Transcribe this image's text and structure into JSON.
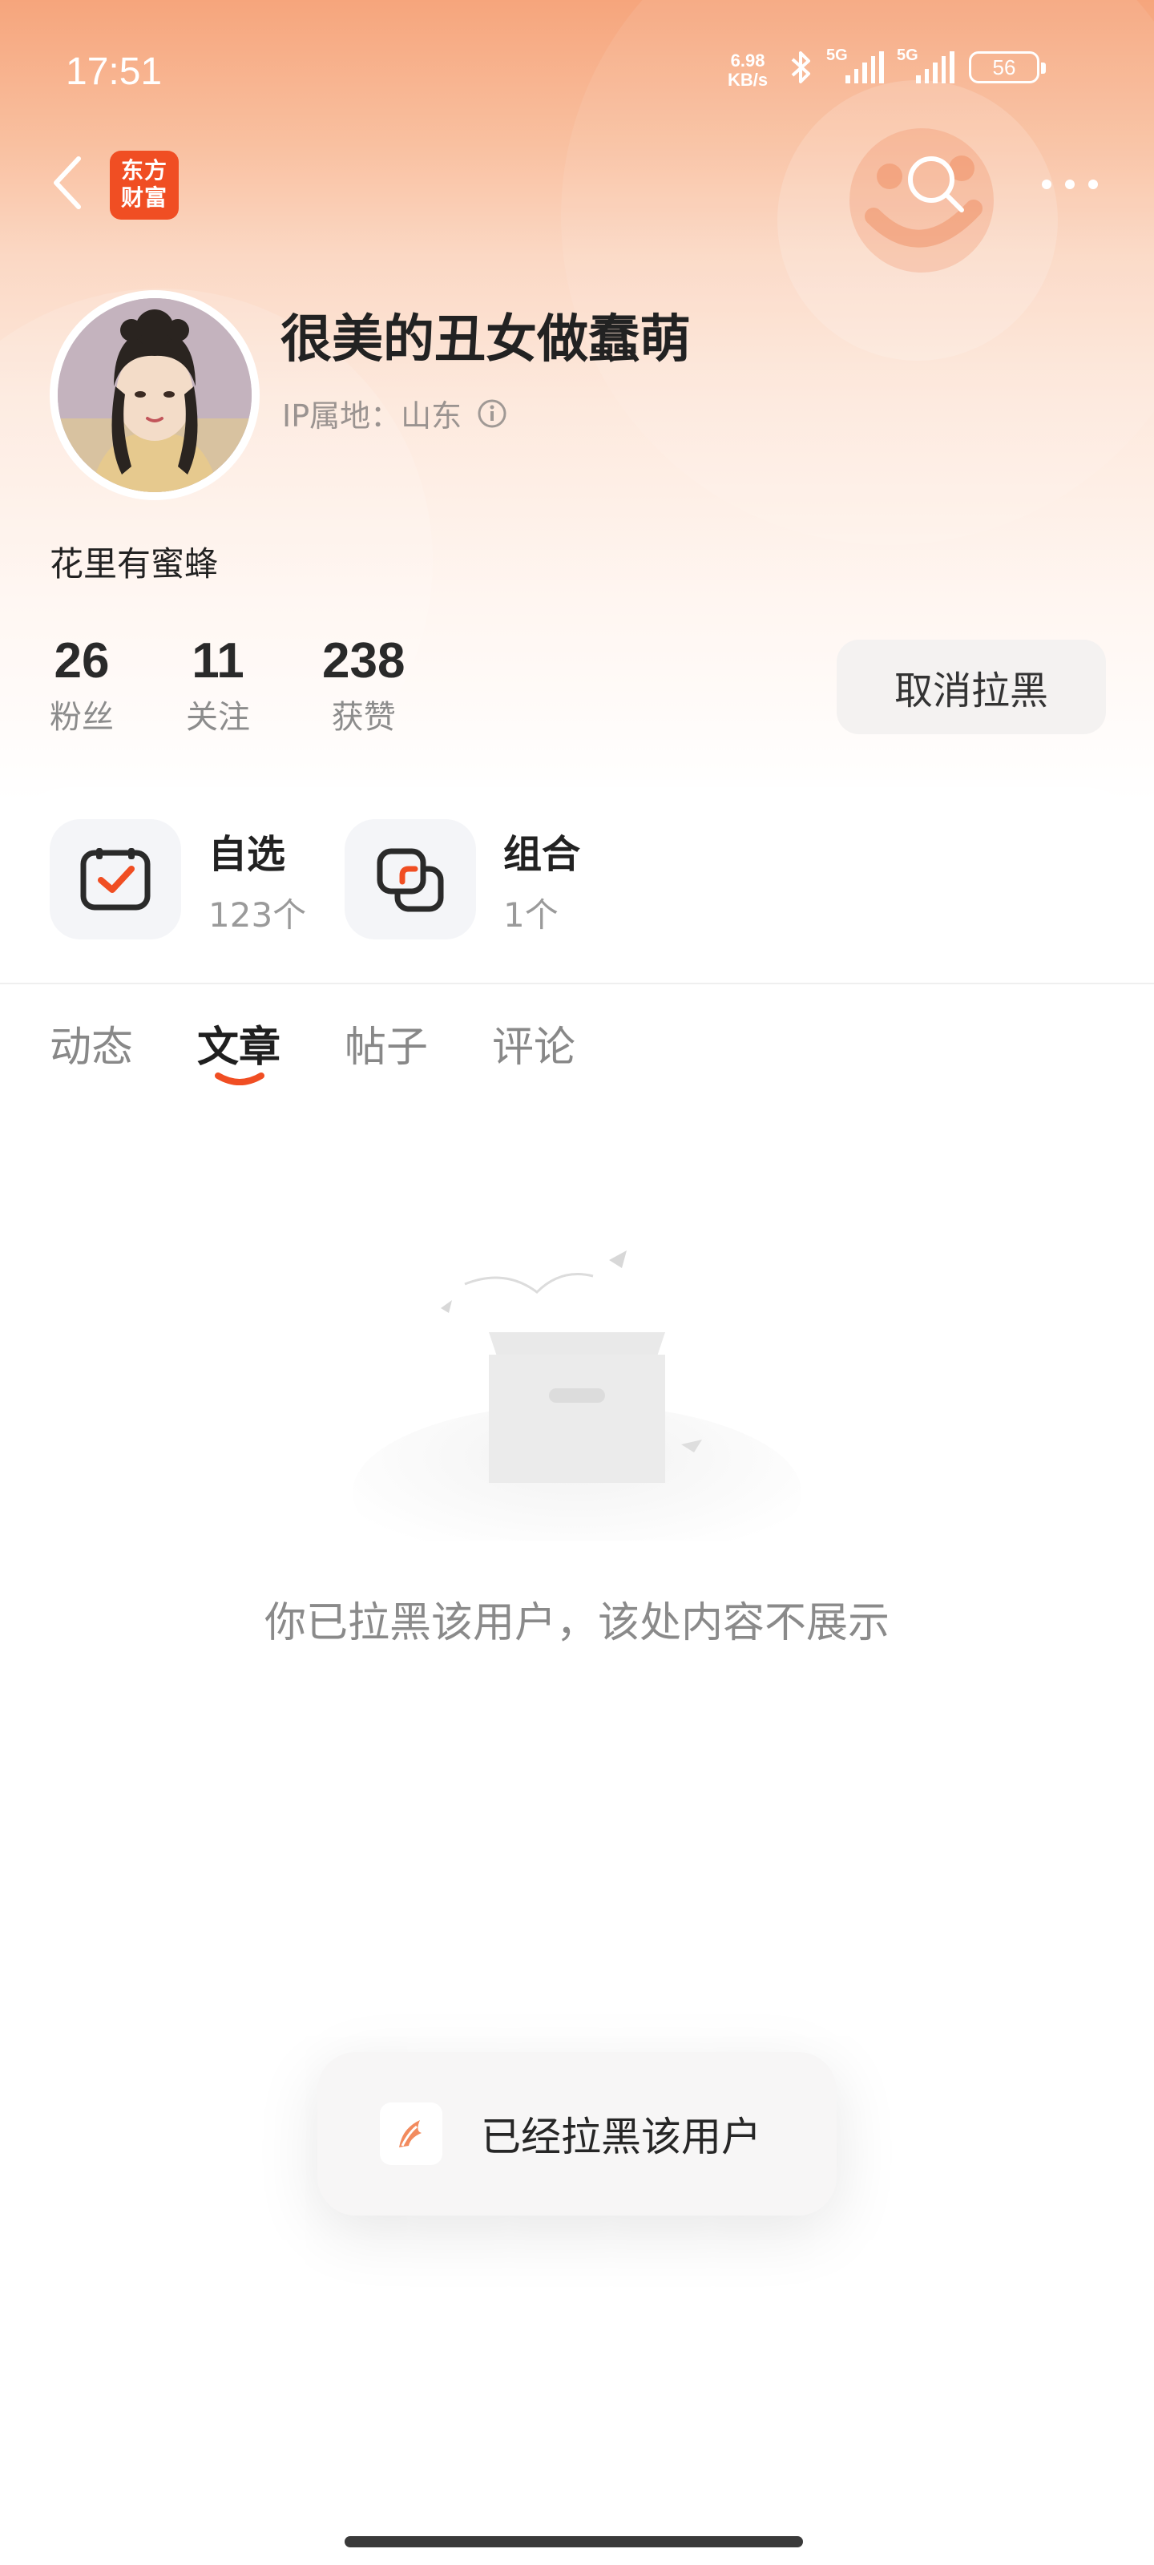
{
  "status_bar": {
    "time": "17:51",
    "net_speed_value": "6.98",
    "net_speed_unit": "KB/s",
    "signal1_label": "5G",
    "signal2_label": "5G",
    "battery": "56"
  },
  "nav": {
    "app_logo_line1": "东方",
    "app_logo_line2": "财富",
    "back_icon": "chevron-left-icon",
    "search_icon": "search-icon",
    "more_icon": "more-dots-icon"
  },
  "profile": {
    "username": "很美的丑女做蠢萌",
    "ip_label": "IP属地：山东",
    "bio": "花里有蜜蜂",
    "stats": [
      {
        "value": "26",
        "label": "粉丝"
      },
      {
        "value": "11",
        "label": "关注"
      },
      {
        "value": "238",
        "label": "获赞"
      }
    ],
    "unblock_button": "取消拉黑"
  },
  "portfolio": [
    {
      "title": "自选",
      "count": "123个",
      "icon": "watchlist-check-icon"
    },
    {
      "title": "组合",
      "count": "1个",
      "icon": "portfolio-combo-icon"
    }
  ],
  "tabs": [
    {
      "label": "动态",
      "active": false
    },
    {
      "label": "文章",
      "active": true
    },
    {
      "label": "帖子",
      "active": false
    },
    {
      "label": "评论",
      "active": false
    }
  ],
  "empty_state": {
    "message": "你已拉黑该用户，该处内容不展示",
    "icon": "empty-box-icon"
  },
  "toast": {
    "message": "已经拉黑该用户",
    "icon": "app-feather-icon"
  },
  "colors": {
    "accent": "#f04e23",
    "header_top": "#f6a57c",
    "text_primary": "#222222",
    "text_secondary": "#8a8a8a"
  }
}
